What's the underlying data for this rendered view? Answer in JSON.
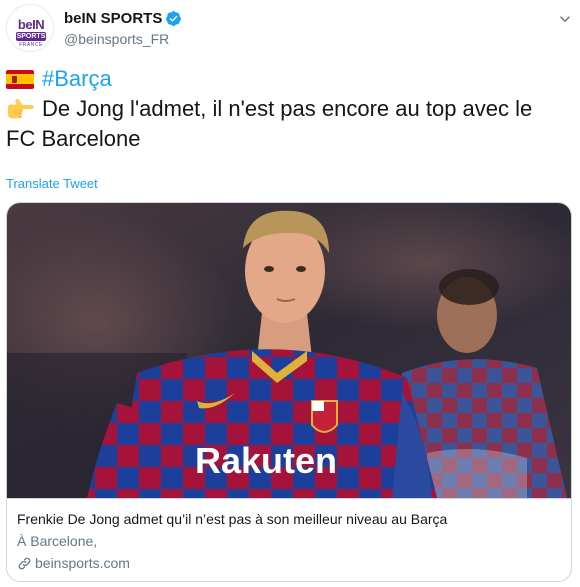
{
  "account": {
    "display_name": "beIN SPORTS",
    "handle": "@beinsports_FR",
    "logo": {
      "word": "beIN",
      "band": "SPORTS",
      "country": "FRANCE"
    },
    "verified_icon": "verified-badge-icon"
  },
  "menu_icon": "chevron-down-icon",
  "tweet": {
    "line1_hashtag": "#Barça",
    "line1_icon": "spain-flag-icon",
    "line2_text": "De Jong l'admet, il n'est pas encore au top avec le",
    "line2_icon": "pointing-right-icon",
    "line3_text": "FC Barcelone"
  },
  "translate_label": "Translate Tweet",
  "card": {
    "jersey_text": "Rakuten",
    "title": "Frenkie De Jong admet qu’il n’est pas à son meilleur niveau au Barça",
    "description": "À Barcelone,",
    "domain": "beinsports.com",
    "link_icon": "link-icon"
  },
  "colors": {
    "link_blue": "#1da1f2",
    "text_primary": "#14171a",
    "text_secondary": "#657786",
    "border": "#ccd6dd",
    "bein_purple": "#5c2d91"
  }
}
